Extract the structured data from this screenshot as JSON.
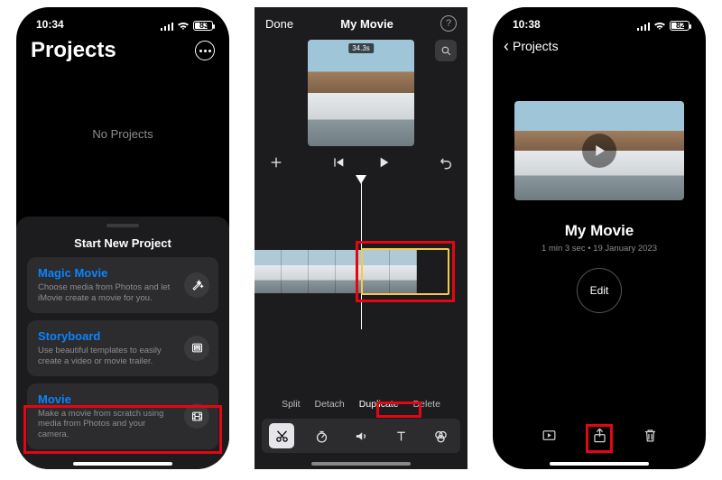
{
  "screen1": {
    "status_time": "10:34",
    "battery_percent": "83",
    "header_title": "Projects",
    "empty_text": "No Projects",
    "sheet_title": "Start New Project",
    "options": [
      {
        "title": "Magic Movie",
        "desc": "Choose media from Photos and let iMovie create a movie for you.",
        "icon": "wand-icon"
      },
      {
        "title": "Storyboard",
        "desc": "Use beautiful templates to easily create a video or movie trailer.",
        "icon": "storyboard-icon"
      },
      {
        "title": "Movie",
        "desc": "Make a movie from scratch using media from Photos and your camera.",
        "icon": "film-icon"
      }
    ]
  },
  "screen2": {
    "done_label": "Done",
    "title": "My Movie",
    "preview_duration": "34.3s",
    "clip_actions": {
      "split": "Split",
      "detach": "Detach",
      "duplicate": "Duplicate",
      "delete": "Delete"
    }
  },
  "screen3": {
    "status_time": "10:38",
    "battery_percent": "82",
    "back_label": "Projects",
    "project_name": "My Movie",
    "project_meta": "1 min 3 sec • 19 January 2023",
    "edit_label": "Edit"
  }
}
